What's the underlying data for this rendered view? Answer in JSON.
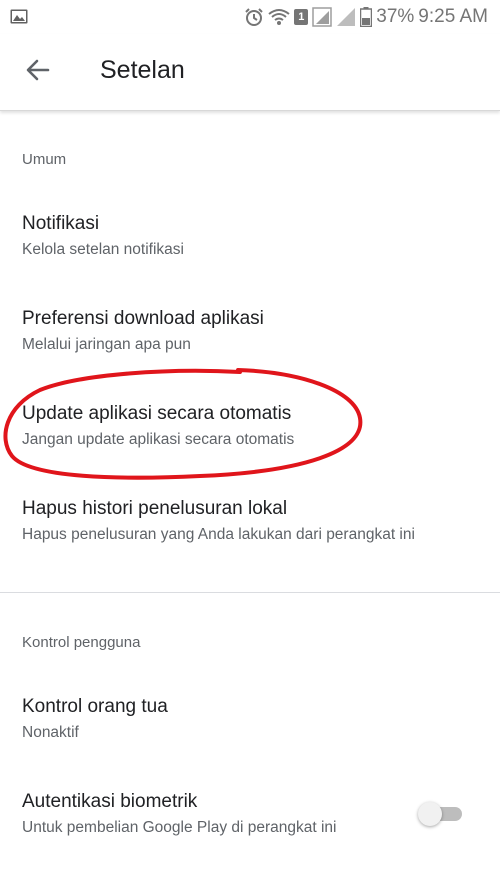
{
  "status_bar": {
    "battery": "37%",
    "time": "9:25 AM",
    "sim_badge": "1",
    "icons": [
      "gallery-icon",
      "alarm-icon",
      "wifi-icon",
      "signal-icon",
      "signal-icon",
      "battery-icon"
    ]
  },
  "app_bar": {
    "title": "Setelan",
    "back_icon": "arrow-back-icon"
  },
  "sections": [
    {
      "header": "Umum",
      "items": [
        {
          "title": "Notifikasi",
          "subtitle": "Kelola setelan notifikasi"
        },
        {
          "title": "Preferensi download aplikasi",
          "subtitle": "Melalui jaringan apa pun"
        },
        {
          "title": "Update aplikasi secara otomatis",
          "subtitle": "Jangan update aplikasi secara otomatis"
        },
        {
          "title": "Hapus histori penelusuran lokal",
          "subtitle": "Hapus penelusuran yang Anda lakukan dari perangkat ini"
        }
      ]
    },
    {
      "header": "Kontrol pengguna",
      "items": [
        {
          "title": "Kontrol orang tua",
          "subtitle": "Nonaktif"
        },
        {
          "title": "Autentikasi biometrik",
          "subtitle": "Untuk pembelian Google Play di perangkat ini",
          "toggle": "off"
        }
      ]
    }
  ],
  "colors": {
    "annotation": "#e0151b",
    "text_primary": "#202124",
    "text_secondary": "#5f6368"
  }
}
